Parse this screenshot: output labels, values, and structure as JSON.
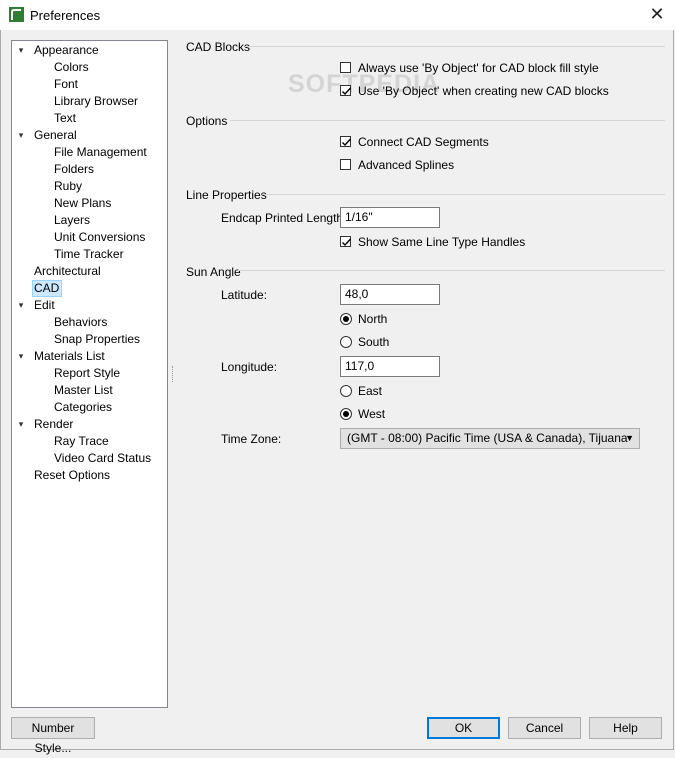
{
  "window": {
    "title": "Preferences",
    "close_glyph": "✕",
    "icon": "chief-architect-app-icon"
  },
  "tree": [
    {
      "label": "Appearance",
      "level": 0,
      "expanded": true
    },
    {
      "label": "Colors",
      "level": 1
    },
    {
      "label": "Font",
      "level": 1
    },
    {
      "label": "Library Browser",
      "level": 1
    },
    {
      "label": "Text",
      "level": 1
    },
    {
      "label": "General",
      "level": 0,
      "expanded": true
    },
    {
      "label": "File Management",
      "level": 1
    },
    {
      "label": "Folders",
      "level": 1
    },
    {
      "label": "Ruby",
      "level": 1
    },
    {
      "label": "New Plans",
      "level": 1
    },
    {
      "label": "Layers",
      "level": 1
    },
    {
      "label": "Unit Conversions",
      "level": 1
    },
    {
      "label": "Time Tracker",
      "level": 1
    },
    {
      "label": "Architectural",
      "level": 0
    },
    {
      "label": "CAD",
      "level": 0,
      "selected": true
    },
    {
      "label": "Edit",
      "level": 0,
      "expanded": true
    },
    {
      "label": "Behaviors",
      "level": 1
    },
    {
      "label": "Snap Properties",
      "level": 1
    },
    {
      "label": "Materials List",
      "level": 0,
      "expanded": true
    },
    {
      "label": "Report Style",
      "level": 1
    },
    {
      "label": "Master List",
      "level": 1
    },
    {
      "label": "Categories",
      "level": 1
    },
    {
      "label": "Render",
      "level": 0,
      "expanded": true
    },
    {
      "label": "Ray Trace",
      "level": 1
    },
    {
      "label": "Video Card Status",
      "level": 1
    },
    {
      "label": "Reset Options",
      "level": 0
    }
  ],
  "sections": {
    "cad_blocks": {
      "title": "CAD Blocks",
      "always_by_object": {
        "label": "Always use 'By Object' for CAD block fill style",
        "checked": false
      },
      "use_by_object": {
        "label": "Use 'By Object' when creating new CAD blocks",
        "checked": true
      }
    },
    "options": {
      "title": "Options",
      "connect_segments": {
        "label": "Connect CAD Segments",
        "checked": true
      },
      "advanced_splines": {
        "label": "Advanced Splines",
        "checked": false
      }
    },
    "line_properties": {
      "title": "Line Properties",
      "endcap_label": "Endcap Printed Length:",
      "endcap_value": "1/16\"",
      "show_handles": {
        "label": "Show Same Line Type Handles",
        "checked": true
      }
    },
    "sun_angle": {
      "title": "Sun Angle",
      "latitude_label": "Latitude:",
      "latitude_value": "48,0",
      "north": {
        "label": "North",
        "selected": true
      },
      "south": {
        "label": "South",
        "selected": false
      },
      "longitude_label": "Longitude:",
      "longitude_value": "117,0",
      "east": {
        "label": "East",
        "selected": false
      },
      "west": {
        "label": "West",
        "selected": true
      },
      "timezone_label": "Time Zone:",
      "timezone_value": "(GMT - 08:00) Pacific Time (USA & Canada), Tijuana"
    }
  },
  "buttons": {
    "number_style": "Number Style...",
    "ok": "OK",
    "cancel": "Cancel",
    "help": "Help"
  },
  "watermark": "SOFTPEDIA",
  "colors": {
    "selection_bg": "#cce8ff",
    "default_button_border": "#0078d7",
    "app_icon_green": "#2e7d32"
  }
}
